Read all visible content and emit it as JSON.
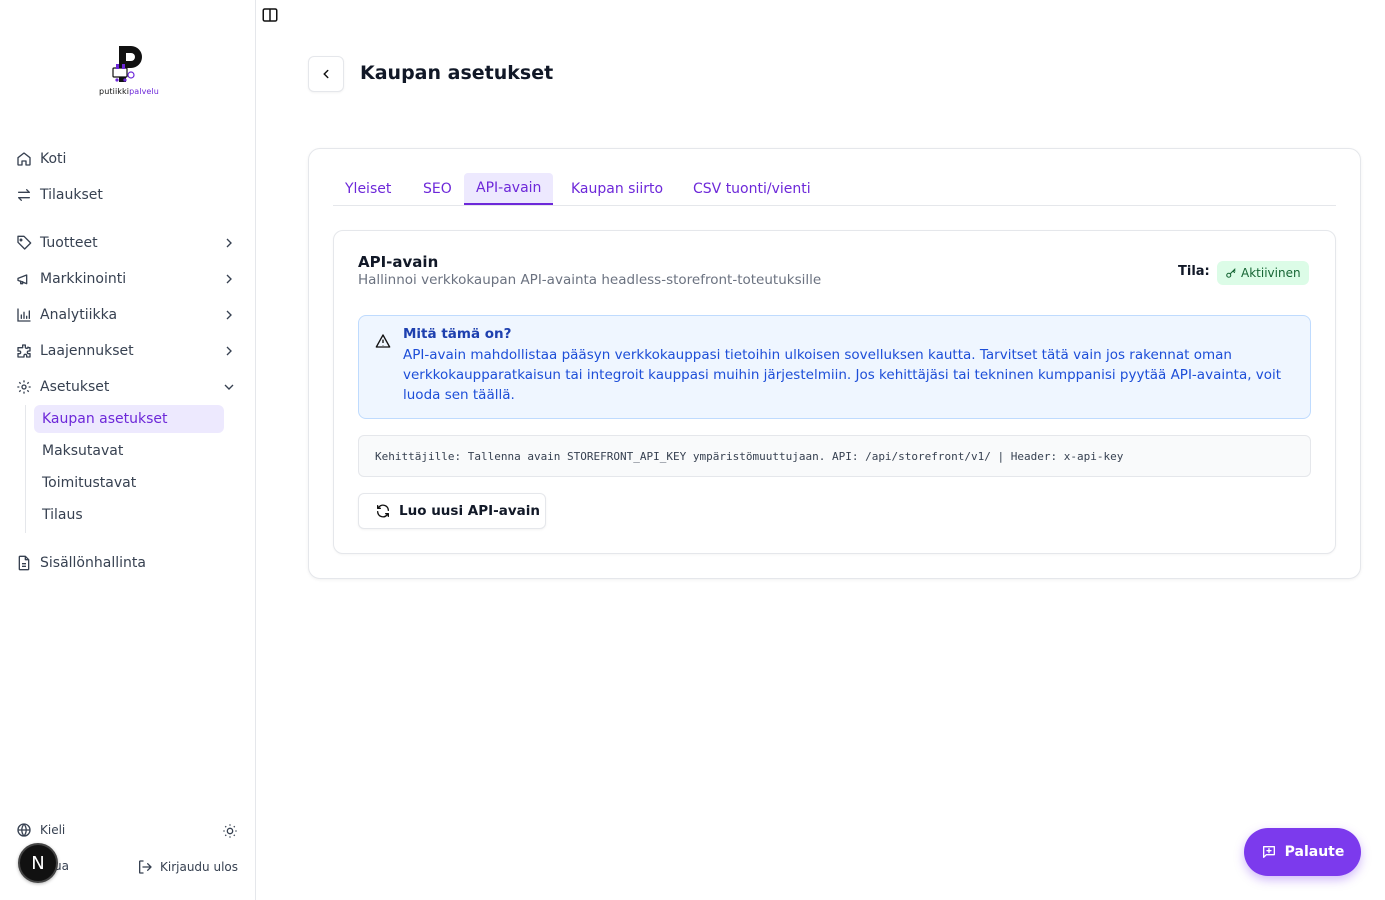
{
  "brand": {
    "logo_text_main": "putiikki",
    "logo_text_accent": "palvelu",
    "accent_color": "#6d28d9"
  },
  "sidebar": {
    "items": [
      {
        "label": "Koti",
        "icon": "home-icon"
      },
      {
        "label": "Tilaukset",
        "icon": "arrows-icon"
      },
      {
        "label": "Tuotteet",
        "icon": "tag-icon"
      },
      {
        "label": "Markkinointi",
        "icon": "megaphone-icon"
      },
      {
        "label": "Analytiikka",
        "icon": "bar-chart-icon"
      },
      {
        "label": "Laajennukset",
        "icon": "puzzle-icon"
      },
      {
        "label": "Asetukset",
        "icon": "gear-icon"
      },
      {
        "label": "Sisällönhallinta",
        "icon": "document-icon"
      }
    ],
    "settings_sub": [
      {
        "label": "Kaupan asetukset"
      },
      {
        "label": "Maksutavat"
      },
      {
        "label": "Toimitustavat"
      },
      {
        "label": "Tilaus"
      }
    ],
    "footer": {
      "language_label": "Kieli",
      "user_label": "ua",
      "logout_label": "Kirjaudu ulos",
      "avatar_letter": "N"
    }
  },
  "header": {
    "title": "Kaupan asetukset"
  },
  "tabs": [
    {
      "label": "Yleiset"
    },
    {
      "label": "SEO"
    },
    {
      "label": "API-avain"
    },
    {
      "label": "Kaupan siirto"
    },
    {
      "label": "CSV tuonti/vienti"
    }
  ],
  "api_card": {
    "title": "API-avain",
    "description": "Hallinnoi verkkokaupan API-avainta headless-storefront-toteutuksille",
    "status_label": "Tila:",
    "status_value": "Aktiivinen",
    "alert_title": "Mitä tämä on?",
    "alert_body": "API-avain mahdollistaa pääsyn verkkokauppasi tietoihin ulkoisen sovelluksen kautta. Tarvitset tätä vain jos rakennat oman verkkokaupparatkaisun tai integroit kauppasi muihin järjestelmiin. Jos kehittäjäsi tai tekninen kumppanisi pyytää API-avainta, voit luoda sen täällä.",
    "dev_note": "Kehittäjille: Tallenna avain STOREFRONT_API_KEY ympäristömuuttujaan. API: /api/storefront/v1/ | Header: x-api-key",
    "generate_button": "Luo uusi API-avain"
  },
  "feedback_button": "Palaute"
}
